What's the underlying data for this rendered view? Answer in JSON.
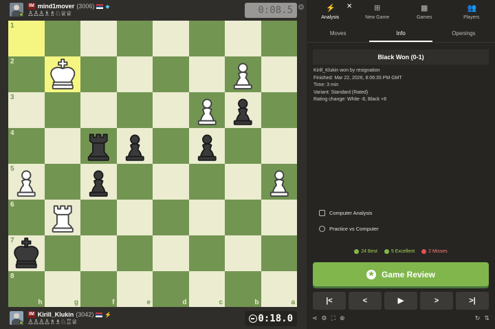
{
  "top_player": {
    "title": "IM",
    "name": "mind1mover",
    "rating": "(3006)",
    "captured": "♙♙♙♗♗♘♕♕",
    "clock": "0:08.5"
  },
  "bottom_player": {
    "title": "IM",
    "name": "Kirill_Klukin",
    "rating": "(3042)",
    "captured": "♙♙♙♙♗♗♘♖♕",
    "clock": "0:18.0"
  },
  "board": {
    "ranks": [
      "1",
      "2",
      "3",
      "4",
      "5",
      "6",
      "7",
      "8"
    ],
    "files": [
      "h",
      "g",
      "f",
      "e",
      "d",
      "c",
      "b",
      "a"
    ],
    "highlighted": [
      "h1",
      "g2"
    ],
    "colors": {
      "light": "#ebecd0",
      "dark": "#739552",
      "highlight_light": "#f5f682",
      "highlight_dark": "#b9ca43"
    },
    "pieces": [
      {
        "square": "g2",
        "piece": "wK"
      },
      {
        "square": "b2",
        "piece": "wP"
      },
      {
        "square": "c3",
        "piece": "wP"
      },
      {
        "square": "b3",
        "piece": "bP"
      },
      {
        "square": "f4",
        "piece": "bR"
      },
      {
        "square": "e4",
        "piece": "bP"
      },
      {
        "square": "c4",
        "piece": "bP"
      },
      {
        "square": "h5",
        "piece": "wP"
      },
      {
        "square": "f5",
        "piece": "bP"
      },
      {
        "square": "a5",
        "piece": "wP"
      },
      {
        "square": "g6",
        "piece": "wR"
      },
      {
        "square": "h7",
        "piece": "bK"
      }
    ]
  },
  "panel": {
    "top_tabs": [
      {
        "label": "Analysis",
        "icon": "analysis-icon"
      },
      {
        "label": "New Game",
        "icon": "new-game-icon"
      },
      {
        "label": "Games",
        "icon": "games-icon"
      },
      {
        "label": "Players",
        "icon": "players-icon"
      }
    ],
    "sub_tabs": [
      "Moves",
      "Info",
      "Openings"
    ],
    "result": "Black Won (0-1)",
    "info": [
      "Kirill_Klukin won by resignation",
      "Finished: Mar 22, 2026, 8:06:35 PM GMT",
      "Time: 3 min",
      "Variant: Standard (Rated)",
      "Rating change: White -8, Black +8"
    ],
    "computer_analysis": "Computer Analysis",
    "practice": "Practice vs Computer",
    "stats": {
      "best": "24 Best",
      "excellent": "5 Excellent",
      "misses": "2 Misses"
    },
    "review_button": "Game Review",
    "nav": [
      "|<",
      "<",
      "▶",
      ">",
      ">|"
    ]
  }
}
